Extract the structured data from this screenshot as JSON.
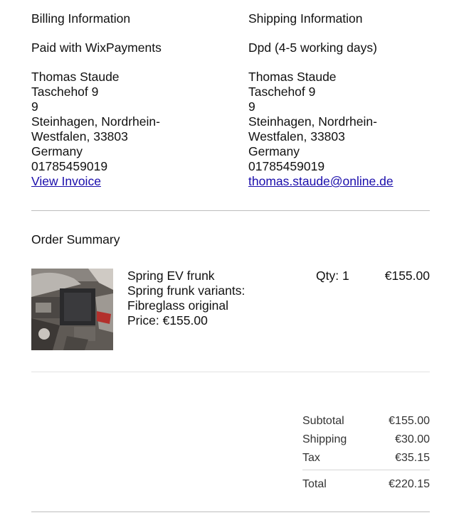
{
  "billing": {
    "heading": "Billing Information",
    "payment_method": "Paid with WixPayments",
    "name": "Thomas Staude",
    "street": "Taschehof 9",
    "street2": "9",
    "city_line1": "Steinhagen, Nordrhein-",
    "city_line2": "Westfalen, 33803",
    "country": "Germany",
    "phone": "01785459019",
    "view_invoice_label": "View Invoice"
  },
  "shipping": {
    "heading": "Shipping Information",
    "delivery_method": "Dpd (4-5 working days)",
    "name": "Thomas Staude",
    "street": "Taschehof 9",
    "street2": "9",
    "city_line1": "Steinhagen, Nordrhein-",
    "city_line2": "Westfalen, 33803",
    "country": "Germany",
    "phone": "01785459019",
    "email": "thomas.staude@online.de"
  },
  "order_summary": {
    "title": "Order Summary",
    "items": [
      {
        "name": "Spring EV frunk",
        "variant_label": "Spring frunk variants:",
        "variant_value": "Fibreglass original",
        "price_text": "Price: €155.00",
        "qty_text": "Qty: 1",
        "line_total": "€155.00",
        "image_icon": "product-photo-engine-bay"
      }
    ]
  },
  "totals": {
    "subtotal_label": "Subtotal",
    "subtotal_value": "€155.00",
    "shipping_label": "Shipping",
    "shipping_value": "€30.00",
    "tax_label": "Tax",
    "tax_value": "€35.15",
    "total_label": "Total",
    "total_value": "€220.15"
  },
  "colors": {
    "link": "#1a0dab",
    "text": "#111111",
    "divider": "#c9c9c9"
  }
}
